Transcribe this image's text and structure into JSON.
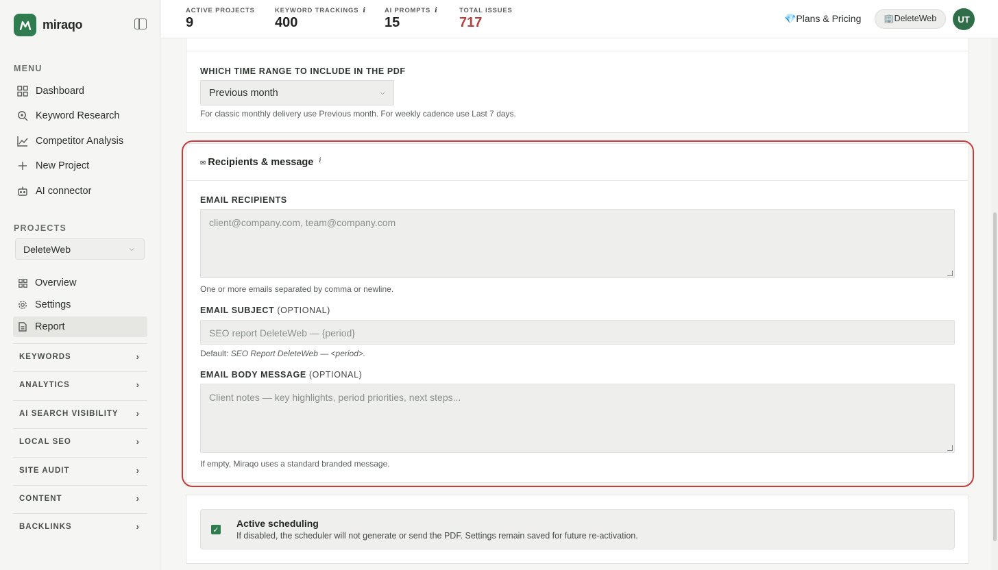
{
  "brand": {
    "name": "miraqo"
  },
  "sidebar": {
    "menu_label": "MENU",
    "menu_items": [
      {
        "label": "Dashboard",
        "icon": "grid-icon"
      },
      {
        "label": "Keyword Research",
        "icon": "magnify-icon"
      },
      {
        "label": "Competitor Analysis",
        "icon": "line-chart-icon"
      },
      {
        "label": "New Project",
        "icon": "plus-icon"
      },
      {
        "label": "AI connector",
        "icon": "robot-icon"
      }
    ],
    "projects_label": "PROJECTS",
    "project_select": "DeleteWeb",
    "project_items": [
      {
        "label": "Overview",
        "icon": "grid-icon"
      },
      {
        "label": "Settings",
        "icon": "gear-icon"
      },
      {
        "label": "Report",
        "icon": "document-icon",
        "active": true
      }
    ],
    "groups": [
      "KEYWORDS",
      "ANALYTICS",
      "AI SEARCH VISIBILITY",
      "LOCAL SEO",
      "SITE AUDIT",
      "CONTENT",
      "BACKLINKS"
    ]
  },
  "topbar": {
    "stats": [
      {
        "label": "ACTIVE PROJECTS",
        "value": "9",
        "info": ""
      },
      {
        "label": "KEYWORD TRACKINGS",
        "value": "400",
        "info": "i"
      },
      {
        "label": "AI PROMPTS",
        "value": "15",
        "info": "i"
      },
      {
        "label": "TOTAL ISSUES",
        "value": "717",
        "info": ""
      }
    ],
    "plans_label": "💎Plans & Pricing",
    "workspace_label": "🏢DeleteWeb",
    "avatar_initials": "UT"
  },
  "time_range": {
    "label": "WHICH TIME RANGE TO INCLUDE IN THE PDF",
    "selected": "Previous month",
    "helper": "For classic monthly delivery use Previous month. For weekly cadence use Last 7 days."
  },
  "recipients": {
    "title": "Recipients & message",
    "title_icon": "✉",
    "info": "i",
    "email_recipients_label": "EMAIL RECIPIENTS",
    "email_recipients_placeholder": "client@company.com, team@company.com",
    "email_recipients_helper": "One or more emails separated by comma or newline.",
    "email_subject_label": "EMAIL SUBJECT",
    "email_subject_optional": "(OPTIONAL)",
    "email_subject_placeholder": "SEO report DeleteWeb — {period}",
    "email_subject_helper_prefix": "Default: ",
    "email_subject_helper_default": "SEO Report DeleteWeb — <period>.",
    "email_body_label": "EMAIL BODY MESSAGE",
    "email_body_optional": "(OPTIONAL)",
    "email_body_placeholder": "Client notes — key highlights, period priorities, next steps...",
    "email_body_helper": "If empty, Miraqo uses a standard branded message."
  },
  "scheduling": {
    "title": "Active scheduling",
    "description": "If disabled, the scheduler will not generate or send the PDF. Settings remain saved for future re-activation.",
    "checked": true
  },
  "colors": {
    "brand_green": "#2f7d4f",
    "issues_red": "#b0413e",
    "highlight_red": "#c73a3a"
  }
}
